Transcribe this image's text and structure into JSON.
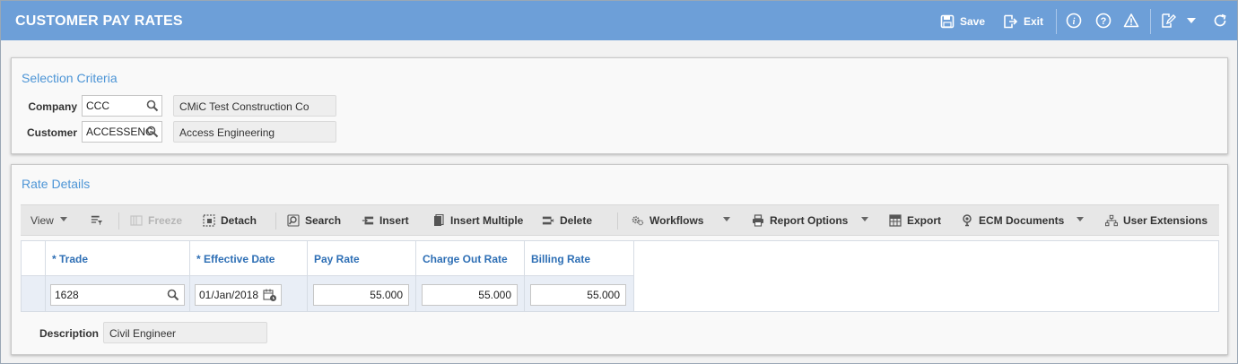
{
  "header": {
    "title": "CUSTOMER PAY RATES",
    "save_label": "Save",
    "exit_label": "Exit"
  },
  "selection": {
    "title": "Selection Criteria",
    "company_label": "Company",
    "company_value": "CCC",
    "company_name": "CMiC Test Construction Co",
    "customer_label": "Customer",
    "customer_value": "ACCESSENG",
    "customer_name": "Access Engineering"
  },
  "rate_details": {
    "title": "Rate Details",
    "toolbar": {
      "view": "View",
      "freeze": "Freeze",
      "detach": "Detach",
      "search": "Search",
      "insert": "Insert",
      "insert_multiple": "Insert Multiple",
      "delete": "Delete",
      "workflows": "Workflows",
      "report_options": "Report Options",
      "export": "Export",
      "ecm_documents": "ECM Documents",
      "user_extensions": "User Extensions"
    },
    "columns": [
      "* Trade",
      "* Effective Date",
      "Pay Rate",
      "Charge Out Rate",
      "Billing Rate"
    ],
    "rows": [
      {
        "trade": "1628",
        "effective_date": "01/Jan/2018",
        "pay_rate": "55.000",
        "charge_out_rate": "55.000",
        "billing_rate": "55.000"
      }
    ],
    "description_label": "Description",
    "description_value": "Civil Engineer"
  },
  "colors": {
    "header_bg": "#6d9fd8",
    "panel_title": "#4d95d6",
    "column_header": "#2e6fb5",
    "selected_row": "#e9eef6"
  }
}
